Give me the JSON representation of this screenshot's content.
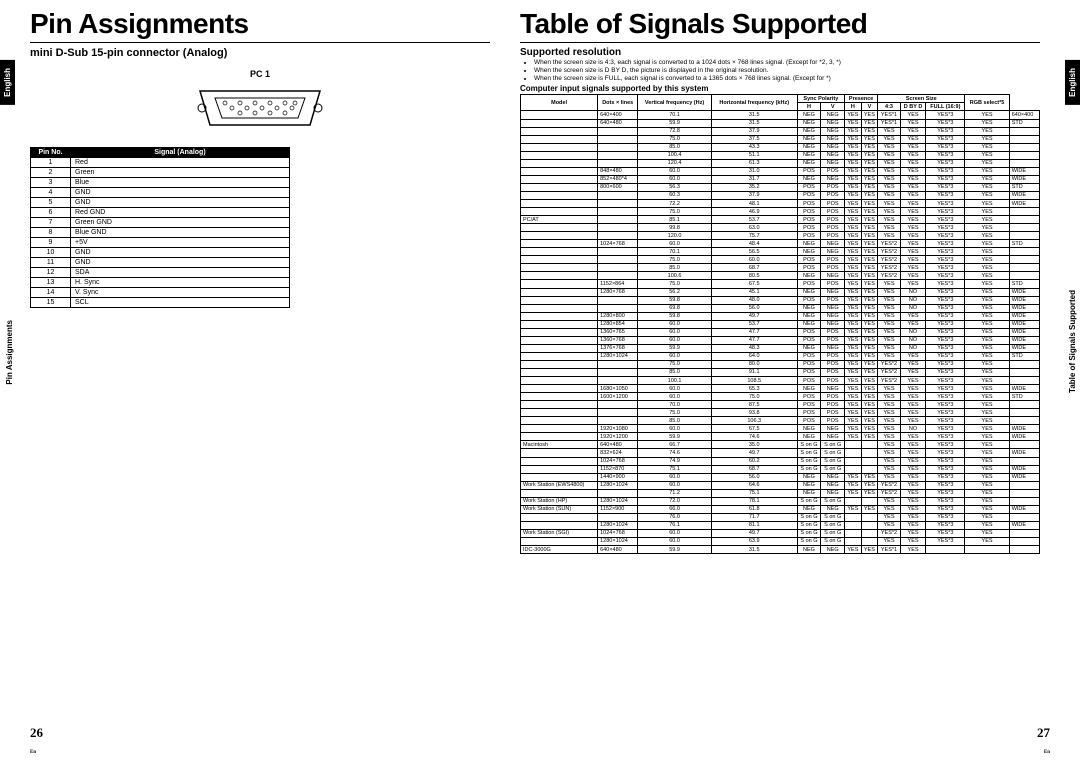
{
  "left": {
    "title": "Pin Assignments",
    "subtitle": "mini D-Sub 15-pin connector (Analog)",
    "connector_label": "PC 1",
    "pin_headers": [
      "Pin No.",
      "Signal (Analog)"
    ],
    "pins": [
      [
        "1",
        "Red"
      ],
      [
        "2",
        "Green"
      ],
      [
        "3",
        "Blue"
      ],
      [
        "4",
        "GND"
      ],
      [
        "5",
        "GND"
      ],
      [
        "6",
        "Red GND"
      ],
      [
        "7",
        "Green GND"
      ],
      [
        "8",
        "Blue GND"
      ],
      [
        "9",
        "+5V"
      ],
      [
        "10",
        "GND"
      ],
      [
        "11",
        "GND"
      ],
      [
        "12",
        "SDA"
      ],
      [
        "13",
        "H. Sync"
      ],
      [
        "14",
        "V. Sync"
      ],
      [
        "15",
        "SCL"
      ]
    ],
    "sidetab": "English",
    "sidelabel": "Pin Assignments",
    "page": "26",
    "en": "En"
  },
  "right": {
    "title": "Table of Signals Supported",
    "subtitle": "Supported resolution",
    "notes": [
      "When the screen size is 4:3, each signal is converted to a 1024 dots × 768 lines signal. (Except for *2, 3, *)",
      "When the screen size is D BY D, the picture is displayed in the original resolution.",
      "When the screen size is FULL, each signal is converted to a 1365 dots × 768 lines signal. (Except for *)"
    ],
    "notes_head": "Computer input signals supported by this system",
    "headers": {
      "model": "Model",
      "dots": "Dots × lines",
      "vf": "Vertical frequency (Hz)",
      "hf": "Horizontal frequency (kHz)",
      "sync": "Sync Polarity",
      "pres": "Presence",
      "ss": "Screen Size",
      "rgb": "RGB select*5",
      "h": "H",
      "v": "V",
      "hp": "H",
      "vp": "V",
      "s43": "4:3",
      "dbyd": "D BY D",
      "full": "FULL (16:9)"
    },
    "rows": [
      [
        "",
        "640×400",
        "70.1",
        "31.5",
        "NEG",
        "NEG",
        "YES",
        "YES",
        "YES*1",
        "YES",
        "YES*3",
        "YES",
        "640×400"
      ],
      [
        "",
        "640×480",
        "59.9",
        "31.5",
        "NEG",
        "NEG",
        "YES",
        "YES",
        "YES*1",
        "YES",
        "YES*3",
        "YES",
        "STD"
      ],
      [
        "",
        "",
        "72.8",
        "37.9",
        "NEG",
        "NEG",
        "YES",
        "YES",
        "YES",
        "YES",
        "YES*3",
        "YES",
        ""
      ],
      [
        "",
        "",
        "75.0",
        "37.5",
        "NEG",
        "NEG",
        "YES",
        "YES",
        "YES",
        "YES",
        "YES*3",
        "YES",
        ""
      ],
      [
        "",
        "",
        "85.0",
        "43.3",
        "NEG",
        "NEG",
        "YES",
        "YES",
        "YES",
        "YES",
        "YES*3",
        "YES",
        ""
      ],
      [
        "",
        "",
        "100.4",
        "51.1",
        "NEG",
        "NEG",
        "YES",
        "YES",
        "YES",
        "YES",
        "YES*3",
        "YES",
        ""
      ],
      [
        "",
        "",
        "120.4",
        "61.3",
        "NEG",
        "NEG",
        "YES",
        "YES",
        "YES",
        "YES",
        "YES*3",
        "YES",
        ""
      ],
      [
        "",
        "848×480",
        "60.0",
        "31.0",
        "POS",
        "POS",
        "YES",
        "YES",
        "YES",
        "YES",
        "YES*3",
        "YES",
        "WIDE"
      ],
      [
        "",
        "852×480*4",
        "60.0",
        "31.7",
        "NEG",
        "NEG",
        "YES",
        "YES",
        "YES",
        "YES",
        "YES*3",
        "YES",
        "WIDE"
      ],
      [
        "",
        "800×600",
        "56.3",
        "35.2",
        "POS",
        "POS",
        "YES",
        "YES",
        "YES",
        "YES",
        "YES*3",
        "YES",
        "STD"
      ],
      [
        "",
        "",
        "60.3",
        "37.9",
        "POS",
        "POS",
        "YES",
        "YES",
        "YES",
        "YES",
        "YES*3",
        "YES",
        "WIDE"
      ],
      [
        "",
        "",
        "72.2",
        "48.1",
        "POS",
        "POS",
        "YES",
        "YES",
        "YES",
        "YES",
        "YES*3",
        "YES",
        "WIDE"
      ],
      [
        "",
        "",
        "75.0",
        "46.9",
        "POS",
        "POS",
        "YES",
        "YES",
        "YES",
        "YES",
        "YES*3",
        "YES",
        ""
      ],
      [
        "PC/AT",
        "",
        "85.1",
        "53.7",
        "POS",
        "POS",
        "YES",
        "YES",
        "YES",
        "YES",
        "YES*3",
        "YES",
        ""
      ],
      [
        "",
        "",
        "99.8",
        "63.0",
        "POS",
        "POS",
        "YES",
        "YES",
        "YES",
        "YES",
        "YES*3",
        "YES",
        ""
      ],
      [
        "",
        "",
        "120.0",
        "75.7",
        "POS",
        "POS",
        "YES",
        "YES",
        "YES",
        "YES",
        "YES*3",
        "YES",
        ""
      ],
      [
        "",
        "1024×768",
        "60.0",
        "48.4",
        "NEG",
        "NEG",
        "YES",
        "YES",
        "YES*2",
        "YES",
        "YES*3",
        "YES",
        "STD"
      ],
      [
        "",
        "",
        "70.1",
        "56.5",
        "NEG",
        "NEG",
        "YES",
        "YES",
        "YES*2",
        "YES",
        "YES*3",
        "YES",
        ""
      ],
      [
        "",
        "",
        "75.0",
        "60.0",
        "POS",
        "POS",
        "YES",
        "YES",
        "YES*2",
        "YES",
        "YES*3",
        "YES",
        ""
      ],
      [
        "",
        "",
        "85.0",
        "68.7",
        "POS",
        "POS",
        "YES",
        "YES",
        "YES*2",
        "YES",
        "YES*3",
        "YES",
        ""
      ],
      [
        "",
        "",
        "100.6",
        "80.5",
        "NEG",
        "NEG",
        "YES",
        "YES",
        "YES*2",
        "YES",
        "YES*3",
        "YES",
        ""
      ],
      [
        "",
        "1152×864",
        "75.0",
        "67.5",
        "POS",
        "POS",
        "YES",
        "YES",
        "YES",
        "YES",
        "YES*3",
        "YES",
        "STD"
      ],
      [
        "",
        "1280×768",
        "56.2",
        "45.1",
        "NEG",
        "NEG",
        "YES",
        "YES",
        "YES",
        "NO",
        "YES*3",
        "YES",
        "WIDE"
      ],
      [
        "",
        "",
        "59.8",
        "48.0",
        "POS",
        "POS",
        "YES",
        "YES",
        "YES",
        "NO",
        "YES*3",
        "YES",
        "WIDE"
      ],
      [
        "",
        "",
        "69.8",
        "56.0",
        "NEG",
        "NEG",
        "YES",
        "YES",
        "YES",
        "NO",
        "YES*3",
        "YES",
        "WIDE"
      ],
      [
        "",
        "1280×800",
        "59.8",
        "49.7",
        "NEG",
        "NEG",
        "YES",
        "YES",
        "YES",
        "YES",
        "YES*3",
        "YES",
        "WIDE"
      ],
      [
        "",
        "1280×854",
        "60.0",
        "53.7",
        "NEG",
        "NEG",
        "YES",
        "YES",
        "YES",
        "YES",
        "YES*3",
        "YES",
        "WIDE"
      ],
      [
        "",
        "1360×765",
        "60.0",
        "47.7",
        "POS",
        "POS",
        "YES",
        "YES",
        "YES",
        "NO",
        "YES*3",
        "YES",
        "WIDE"
      ],
      [
        "",
        "1360×768",
        "60.0",
        "47.7",
        "POS",
        "POS",
        "YES",
        "YES",
        "YES",
        "NO",
        "YES*3",
        "YES",
        "WIDE"
      ],
      [
        "",
        "1376×768",
        "59.9",
        "48.3",
        "NEG",
        "NEG",
        "YES",
        "YES",
        "YES",
        "NO",
        "YES*3",
        "YES",
        "WIDE"
      ],
      [
        "",
        "1280×1024",
        "60.0",
        "64.0",
        "POS",
        "POS",
        "YES",
        "YES",
        "YES",
        "YES",
        "YES*3",
        "YES",
        "STD"
      ],
      [
        "",
        "",
        "75.0",
        "80.0",
        "POS",
        "POS",
        "YES",
        "YES",
        "YES*2",
        "YES",
        "YES*3",
        "YES",
        ""
      ],
      [
        "",
        "",
        "85.0",
        "91.1",
        "POS",
        "POS",
        "YES",
        "YES",
        "YES*2",
        "YES",
        "YES*3",
        "YES",
        ""
      ],
      [
        "",
        "",
        "100.1",
        "108.5",
        "POS",
        "POS",
        "YES",
        "YES",
        "YES*2",
        "YES",
        "YES*3",
        "YES",
        ""
      ],
      [
        "",
        "1680×1050",
        "60.0",
        "65.3",
        "NEG",
        "NEG",
        "YES",
        "YES",
        "YES",
        "YES",
        "YES*3",
        "YES",
        "WIDE"
      ],
      [
        "",
        "1600×1200",
        "60.0",
        "75.0",
        "POS",
        "POS",
        "YES",
        "YES",
        "YES",
        "YES",
        "YES*3",
        "YES",
        "STD"
      ],
      [
        "",
        "",
        "70.0",
        "87.5",
        "POS",
        "POS",
        "YES",
        "YES",
        "YES",
        "YES",
        "YES*3",
        "YES",
        ""
      ],
      [
        "",
        "",
        "75.0",
        "93.8",
        "POS",
        "POS",
        "YES",
        "YES",
        "YES",
        "YES",
        "YES*3",
        "YES",
        ""
      ],
      [
        "",
        "",
        "85.0",
        "106.3",
        "POS",
        "POS",
        "YES",
        "YES",
        "YES",
        "YES",
        "YES*3",
        "YES",
        ""
      ],
      [
        "",
        "1920×1080",
        "60.0",
        "67.5",
        "NEG",
        "NEG",
        "YES",
        "YES",
        "YES",
        "NO",
        "YES*3",
        "YES",
        "WIDE"
      ],
      [
        "",
        "1920×1200",
        "59.9",
        "74.6",
        "NEG",
        "NEG",
        "YES",
        "YES",
        "YES",
        "YES",
        "YES*3",
        "YES",
        "WIDE"
      ],
      [
        "Macintosh",
        "640×480",
        "66.7",
        "35.0",
        "S on G",
        "S on G",
        "",
        "",
        "YES",
        "YES",
        "YES*3",
        "YES",
        ""
      ],
      [
        "",
        "832×624",
        "74.6",
        "49.7",
        "S on G",
        "S on G",
        "",
        "",
        "YES",
        "YES",
        "YES*3",
        "YES",
        "WIDE"
      ],
      [
        "",
        "1024×768",
        "74.9",
        "60.2",
        "S on G",
        "S on G",
        "",
        "",
        "YES",
        "YES",
        "YES*3",
        "YES",
        ""
      ],
      [
        "",
        "1152×870",
        "75.1",
        "68.7",
        "S on G",
        "S on G",
        "",
        "",
        "YES",
        "YES",
        "YES*3",
        "YES",
        "WIDE"
      ],
      [
        "",
        "1440×900",
        "60.0",
        "56.0",
        "NEG",
        "NEG",
        "YES",
        "YES",
        "YES",
        "YES",
        "YES*3",
        "YES",
        "WIDE"
      ],
      [
        "Work Station (EWS4800)",
        "1280×1024",
        "60.0",
        "64.6",
        "NEG",
        "NEG",
        "YES",
        "YES",
        "YES*2",
        "YES",
        "YES*3",
        "YES",
        ""
      ],
      [
        "",
        "",
        "71.2",
        "75.1",
        "NEG",
        "NEG",
        "YES",
        "YES",
        "YES*2",
        "YES",
        "YES*3",
        "YES",
        ""
      ],
      [
        "Work Station (HP)",
        "1280×1024",
        "72.0",
        "78.1",
        "S on G",
        "S on G",
        "",
        "",
        "YES",
        "YES",
        "YES*3",
        "YES",
        ""
      ],
      [
        "Work Station (SUN)",
        "1152×900",
        "66.0",
        "61.8",
        "NEG",
        "NEG",
        "YES",
        "YES",
        "YES",
        "YES",
        "YES*3",
        "YES",
        "WIDE"
      ],
      [
        "",
        "",
        "76.0",
        "71.7",
        "S on G",
        "S on G",
        "",
        "",
        "YES",
        "YES",
        "YES*3",
        "YES",
        ""
      ],
      [
        "",
        "1280×1024",
        "76.1",
        "81.1",
        "S on G",
        "S on G",
        "",
        "",
        "YES",
        "YES",
        "YES*3",
        "YES",
        "WIDE"
      ],
      [
        "Work Station (SGI)",
        "1024×768",
        "60.0",
        "49.7",
        "S on G",
        "S on G",
        "",
        "",
        "YES*2",
        "YES",
        "YES*3",
        "YES",
        ""
      ],
      [
        "",
        "1280×1024",
        "60.0",
        "63.9",
        "S on G",
        "S on G",
        "",
        "",
        "YES",
        "YES",
        "YES*3",
        "YES",
        ""
      ],
      [
        "IDC-3000G",
        "640×480",
        "59.9",
        "31.5",
        "NEG",
        "NEG",
        "YES",
        "YES",
        "YES*1",
        "YES",
        "",
        "",
        ""
      ]
    ],
    "sidetab": "English",
    "sidelabel": "Table of Signals Supported",
    "page": "27",
    "en": "En"
  },
  "chart_data": {
    "type": "table",
    "title": "Computer input signals supported by this system"
  }
}
